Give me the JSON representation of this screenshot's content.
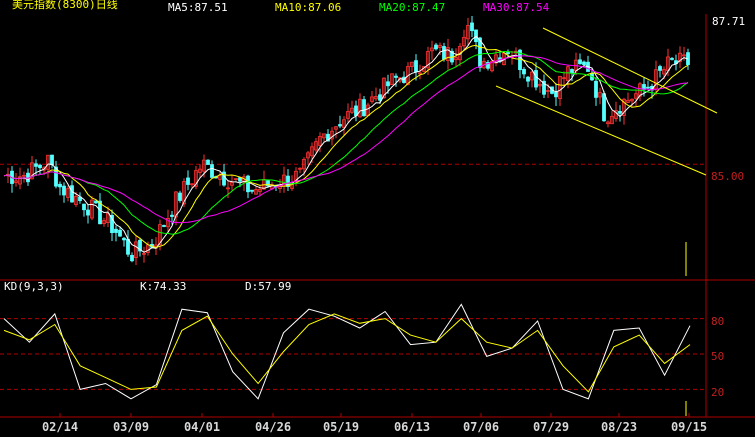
{
  "header": {
    "title": "美元指数(8300)日线",
    "ma5": "MA5:87.51",
    "ma10": "MA10:87.06",
    "ma20": "MA20:87.47",
    "ma30": "MA30:87.54"
  },
  "kd_header": {
    "name": "KD(9,3,3)",
    "k": "K:74.33",
    "d": "D:57.99"
  },
  "price_axis": {
    "last_price": "87.71",
    "ref_level": "85.00"
  },
  "kd_axis": [
    "80",
    "50",
    "20"
  ],
  "x_labels": [
    "02/14",
    "03/09",
    "04/01",
    "04/26",
    "05/19",
    "06/13",
    "07/06",
    "07/29",
    "08/23",
    "09/15"
  ],
  "colors": {
    "background": "#000000",
    "up_candle": "#ff3232",
    "down_candle": "#54ffff",
    "ma5": "#ffffff",
    "ma10": "#ffff00",
    "ma20": "#00ff00",
    "ma30": "#ff00ff",
    "k_line": "#ffffff",
    "d_line": "#ffff00",
    "axis": "#b00000",
    "channel": "#ffff00"
  },
  "chart_data": [
    {
      "type": "candlestick",
      "title": "美元指数(8300)日线",
      "x_ticks": [
        "02/14",
        "03/09",
        "04/01",
        "04/26",
        "05/19",
        "06/13",
        "07/06",
        "07/29",
        "08/23",
        "09/15"
      ],
      "reference_line": 85.0,
      "last_value": 87.71,
      "close_path": [
        {
          "date": "02/01",
          "close": 84.7
        },
        {
          "date": "02/10",
          "close": 85.1
        },
        {
          "date": "02/14",
          "close": 84.4
        },
        {
          "date": "02/24",
          "close": 83.9
        },
        {
          "date": "03/03",
          "close": 83.3
        },
        {
          "date": "03/09",
          "close": 82.6
        },
        {
          "date": "03/16",
          "close": 82.9
        },
        {
          "date": "03/23",
          "close": 84.0
        },
        {
          "date": "04/01",
          "close": 85.0
        },
        {
          "date": "04/08",
          "close": 84.7
        },
        {
          "date": "04/19",
          "close": 84.3
        },
        {
          "date": "04/26",
          "close": 84.5
        },
        {
          "date": "05/05",
          "close": 84.7
        },
        {
          "date": "05/12",
          "close": 85.7
        },
        {
          "date": "05/19",
          "close": 86.2
        },
        {
          "date": "05/26",
          "close": 86.5
        },
        {
          "date": "06/06",
          "close": 87.2
        },
        {
          "date": "06/13",
          "close": 87.5
        },
        {
          "date": "06/20",
          "close": 88.0
        },
        {
          "date": "06/27",
          "close": 87.9
        },
        {
          "date": "07/01",
          "close": 88.8
        },
        {
          "date": "07/06",
          "close": 87.7
        },
        {
          "date": "07/15",
          "close": 88.1
        },
        {
          "date": "07/20",
          "close": 87.6
        },
        {
          "date": "07/29",
          "close": 86.9
        },
        {
          "date": "08/05",
          "close": 87.5
        },
        {
          "date": "08/12",
          "close": 87.6
        },
        {
          "date": "08/18",
          "close": 86.3
        },
        {
          "date": "08/23",
          "close": 86.6
        },
        {
          "date": "09/01",
          "close": 87.0
        },
        {
          "date": "09/09",
          "close": 87.7
        }
      ],
      "moving_averages": [
        {
          "name": "MA5",
          "value": 87.51
        },
        {
          "name": "MA10",
          "value": 87.06
        },
        {
          "name": "MA20",
          "value": 87.47
        },
        {
          "name": "MA30",
          "value": 87.54
        }
      ]
    },
    {
      "type": "line",
      "title": "KD(9,3,3)",
      "ylim": [
        0,
        100
      ],
      "y_ticks": [
        20,
        50,
        80
      ],
      "series": [
        {
          "name": "K",
          "last": 74.33,
          "values": [
            80,
            60,
            84,
            20,
            25,
            12,
            24,
            88,
            85,
            35,
            12,
            68,
            88,
            82,
            72,
            86,
            58,
            60,
            92,
            48,
            55,
            78,
            20,
            12,
            70,
            72,
            32,
            74
          ]
        },
        {
          "name": "D",
          "last": 57.99,
          "values": [
            70,
            62,
            75,
            40,
            30,
            20,
            22,
            70,
            82,
            50,
            25,
            52,
            75,
            84,
            76,
            80,
            66,
            60,
            80,
            60,
            55,
            70,
            40,
            18,
            56,
            66,
            42,
            58
          ]
        }
      ]
    }
  ]
}
